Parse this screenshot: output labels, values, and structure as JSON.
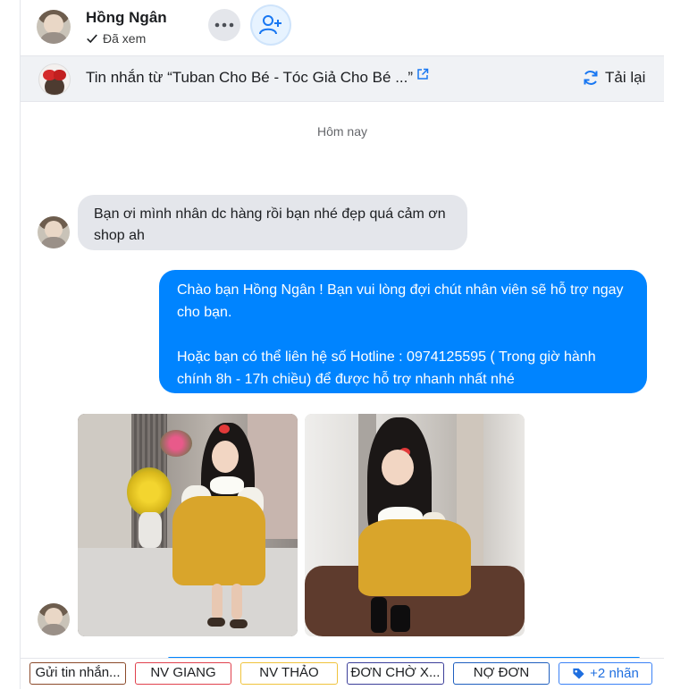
{
  "header": {
    "name": "Hồng Ngân",
    "status": "Đã xem"
  },
  "source_bar": {
    "text": "Tin nhắn từ  “Tuban Cho Bé - Tóc Giả Cho Bé ...”",
    "reload_label": "Tải lại"
  },
  "chat": {
    "day_separator": "Hôm nay",
    "incoming_message": "Bạn ơi mình nhân dc hàng rồi bạn nhé đẹp quá cảm ơn shop ah",
    "outgoing_message": {
      "paragraph1": "Chào bạn Hồng Ngân ! Bạn vui lòng đợi chút nhân viên sẽ hỗ trợ ngay cho bạn.",
      "paragraph2": "Hoặc bạn có thể liên hệ số Hotline : 0974125595 ( Trong giờ hành chính 8h - 17h chiều) để được hỗ trợ nhanh nhất nhé"
    }
  },
  "labels": {
    "items": [
      "Gửi tin nhắn...",
      "NV GIANG",
      "NV THẢO",
      "ĐƠN CHỜ X...",
      "NỢ ĐƠN"
    ],
    "more": "+2 nhãn"
  },
  "colors": {
    "outgoing_bubble": "#0084ff",
    "incoming_bubble": "#e4e6eb",
    "label_1": "#8b4a2a",
    "label_2": "#e0414d",
    "label_3": "#f0c33c",
    "label_4": "#3c3f9a",
    "label_5": "#1f5fbf",
    "label_more": "#3b82f6"
  },
  "icons": [
    "check-icon",
    "more-icon",
    "add-friend-icon",
    "external-link-icon",
    "refresh-icon",
    "tag-icon"
  ]
}
